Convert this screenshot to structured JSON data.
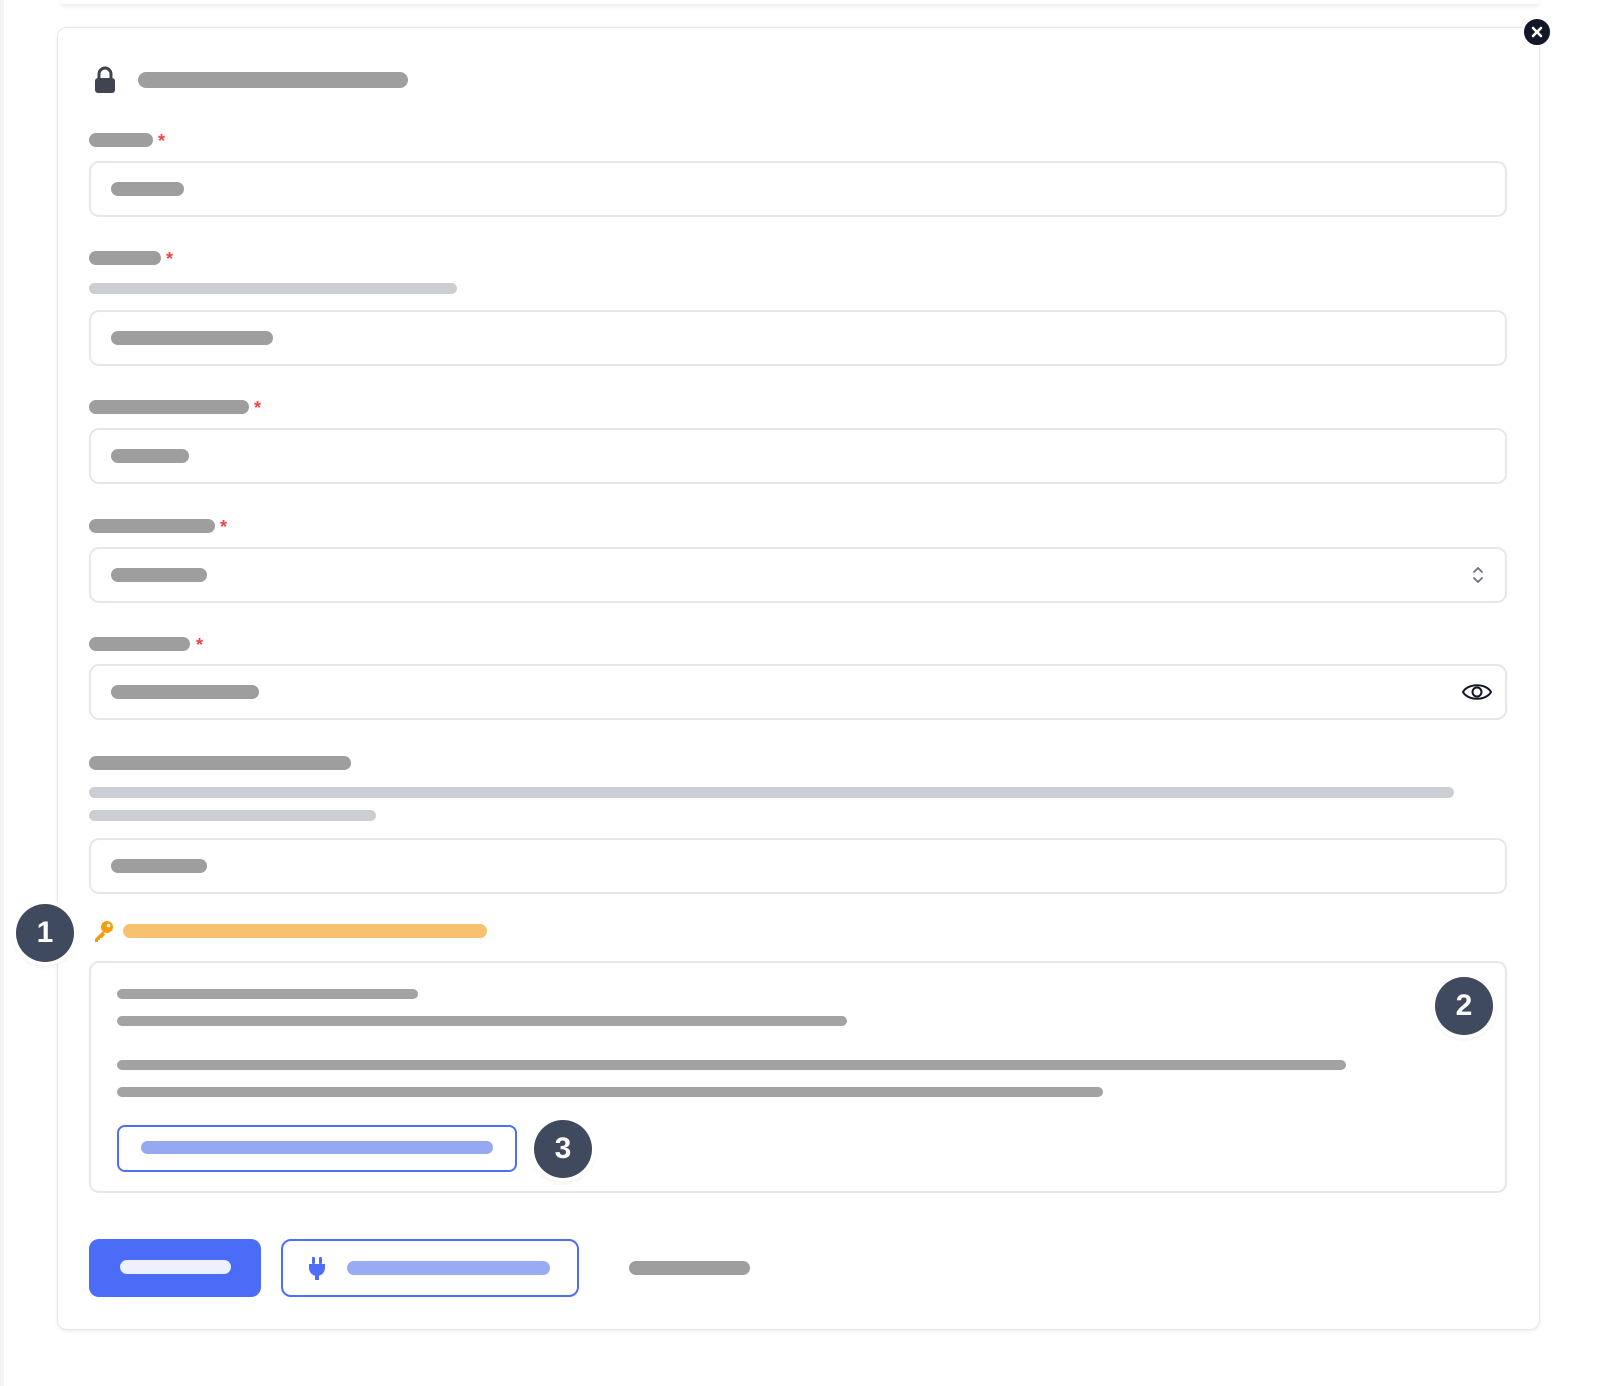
{
  "dialog": {
    "title": "",
    "close_icon": "close-icon",
    "lock_icon": "lock-icon"
  },
  "fields": [
    {
      "label": "",
      "required": true,
      "required_mark": "*",
      "value": ""
    },
    {
      "label": "",
      "required": true,
      "required_mark": "*",
      "help": "",
      "value": ""
    },
    {
      "label": "",
      "required": true,
      "required_mark": "*",
      "value": ""
    },
    {
      "label": "",
      "required": true,
      "required_mark": "*",
      "value": "",
      "control": "select",
      "icon": "chevron-updown-icon"
    },
    {
      "label": "",
      "required": true,
      "required_mark": "*",
      "value": "",
      "control": "password",
      "icon": "eye-icon"
    },
    {
      "label": "",
      "required": false,
      "help_lines": [
        "",
        ""
      ],
      "value": ""
    }
  ],
  "key_section": {
    "icon": "key-icon",
    "title": "",
    "accent_color": "#f59e0b",
    "panel_lines": [
      "",
      "",
      "",
      ""
    ],
    "link_button_label": ""
  },
  "callouts": [
    "1",
    "2",
    "3"
  ],
  "actions": {
    "primary_label": "",
    "secondary_label": "",
    "secondary_icon": "plug-icon",
    "tertiary_label": ""
  },
  "colors": {
    "primary": "#4a6cf7",
    "required": "#ef4444",
    "badge": "#3f4a5e",
    "accent": "#f59e0b"
  }
}
